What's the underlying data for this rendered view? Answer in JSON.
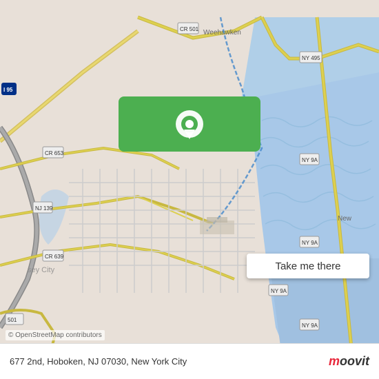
{
  "map": {
    "background_color": "#e8e0d8",
    "center_lat": 40.744,
    "center_lng": -74.028
  },
  "location_card": {
    "background_color": "#4caf50",
    "pin_color": "#ffffff",
    "button_label": "Take me there",
    "button_bg": "#ffffff",
    "button_text_color": "#333333"
  },
  "bottom_bar": {
    "address": "677 2nd, Hoboken, NJ 07030, New York City",
    "copyright": "© OpenStreetMap contributors",
    "logo_text": "moovit",
    "logo_dot_color": "#e8283c"
  },
  "icons": {
    "map_pin": "📍"
  }
}
